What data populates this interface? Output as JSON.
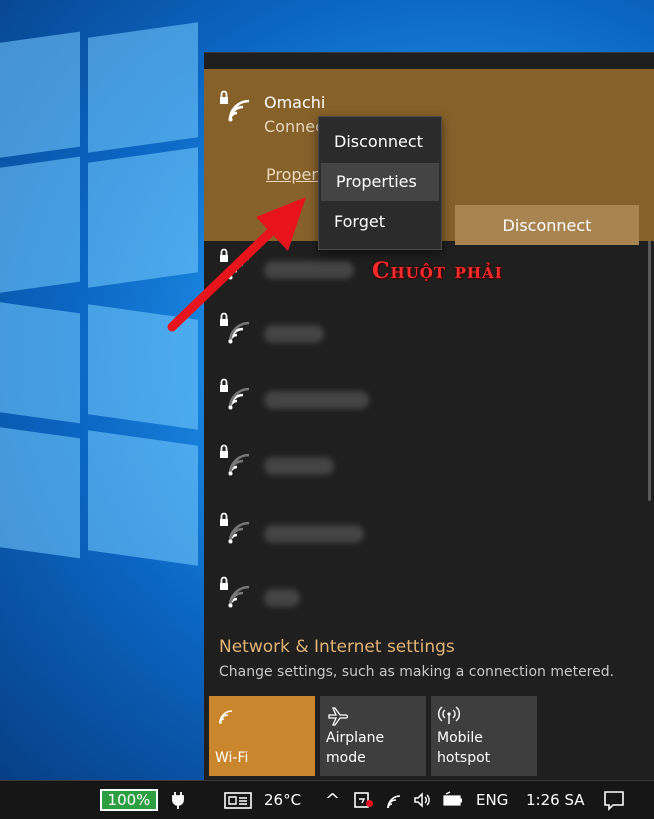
{
  "connected_network": {
    "name": "Omachi",
    "status": "Connected, secured",
    "properties_link": "Properties",
    "disconnect_label": "Disconnect"
  },
  "context_menu": {
    "items": [
      {
        "label": "Disconnect"
      },
      {
        "label": "Properties"
      },
      {
        "label": "Forget"
      }
    ],
    "highlighted": "Properties"
  },
  "annotation": {
    "text": "Chuột phải",
    "color": "#ff2a2a"
  },
  "networks": {
    "count": 6,
    "names_blurred": true
  },
  "settings": {
    "link": "Network & Internet settings",
    "description": "Change settings, such as making a connection metered."
  },
  "quick_actions": [
    {
      "label": "Wi-Fi",
      "icon": "wifi-icon",
      "active": true
    },
    {
      "label": "Airplane mode",
      "icon": "airplane-icon",
      "active": false
    },
    {
      "label": "Mobile hotspot",
      "label_line1": "Mobile",
      "label_line2": "hotspot",
      "icon": "hotspot-icon",
      "active": false
    }
  ],
  "taskbar": {
    "battery_percent": "100%",
    "temperature": "26°C",
    "language": "ENG",
    "time": "1:26 SA"
  },
  "colors": {
    "accent": "#c9862c",
    "connected_bg": "#87612a",
    "panel_bg": "#1f1f1f"
  }
}
